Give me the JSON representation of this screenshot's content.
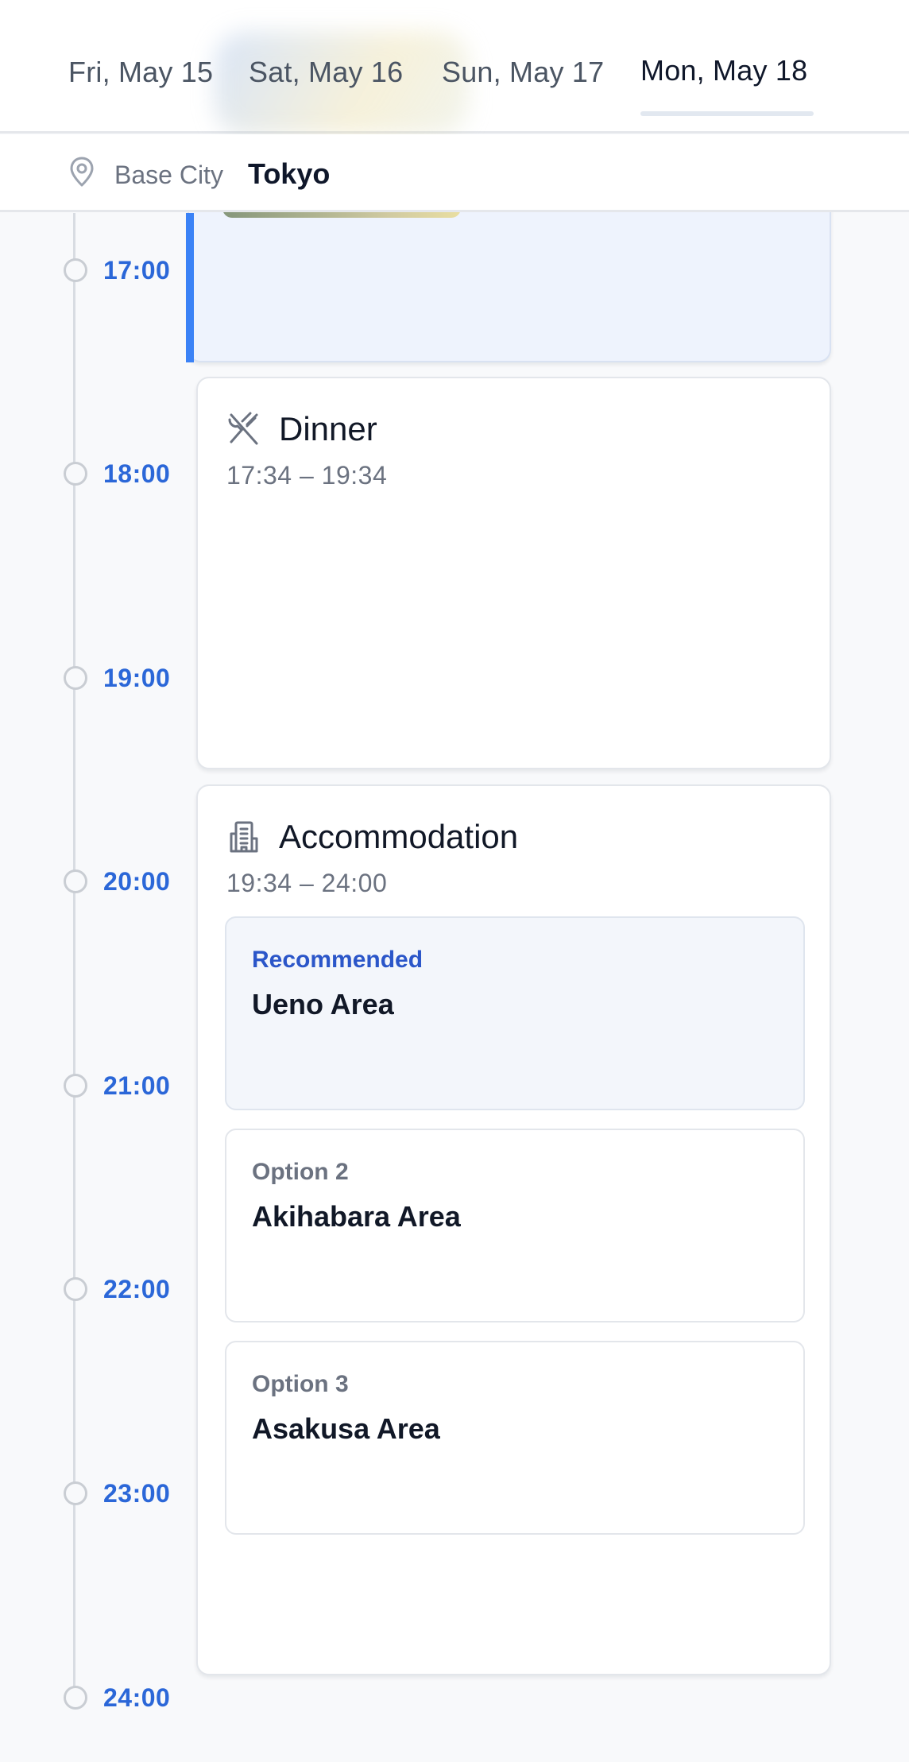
{
  "header": {
    "tabs": [
      {
        "label": "Fri, May 15",
        "active": false
      },
      {
        "label": "Sat, May 16",
        "active": false
      },
      {
        "label": "Sun, May 17",
        "active": false
      },
      {
        "label": "Mon, May 18",
        "active": true
      }
    ],
    "base_city_label": "Base City",
    "base_city_value": "Tokyo"
  },
  "timeline": {
    "hours": [
      "17:00",
      "18:00",
      "19:00",
      "20:00",
      "21:00",
      "22:00",
      "23:00",
      "24:00"
    ]
  },
  "events": {
    "dinner": {
      "title": "Dinner",
      "time": "17:34 – 19:34",
      "icon": "utensils-crossed-icon"
    },
    "accommodation": {
      "title": "Accommodation",
      "time": "19:34 – 24:00",
      "icon": "building-icon",
      "options": [
        {
          "tag": "Recommended",
          "name": "Ueno Area"
        },
        {
          "tag": "Option 2",
          "name": "Akihabara Area"
        },
        {
          "tag": "Option 3",
          "name": "Asakusa Area"
        }
      ]
    }
  },
  "colors": {
    "accent": "#3b82f6",
    "hour_label": "#2b67d8",
    "recommended_tag": "#2b56c9"
  }
}
